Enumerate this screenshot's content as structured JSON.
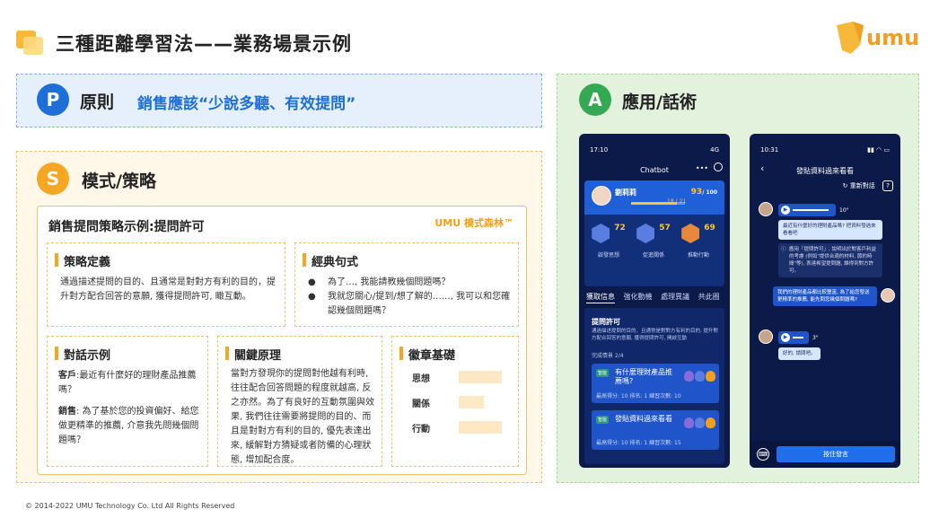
{
  "header": {
    "title": "三種距離學習法——業務場景示例",
    "logo_text": "umu"
  },
  "principle": {
    "badge": "P",
    "label": "原則",
    "text": "銷售應該“少說多聽、有效提問”"
  },
  "strategy": {
    "badge": "S",
    "label": "模式/策略",
    "card_title": "銷售提問策略示例:提問許可",
    "brand": "UMU 模式森林™",
    "definition": {
      "title": "策略定義",
      "text": "通過描述提問的目的、且通常是對對方有利的目的，提升對方配合回答的意願, 獲得提問許可, 瞰互動。"
    },
    "classic": {
      "title": "經典句式",
      "items": [
        "為了…, 我能請教幾個問題嗎？",
        "我就您關心/提到/想了解的……, 我可以和您確認幾個問題嗎？"
      ]
    },
    "dialog": {
      "title": "對話示例",
      "customer_label": "客戶",
      "customer_text": ":最近有什麼好的理財產品推薦嗎？",
      "sales_label": "銷售",
      "sales_text": ": 為了基於您的投資偏好、給您做更精準的推薦, 介意我先問幾個問題嗎？"
    },
    "key": {
      "title": "關鍵原理",
      "text": "當對方發現你的提問對他越有利時, 往往配合回答問題的程度就越高, 反之亦然。為了有良好的互動氛圍與效果, 我們往往需要將提問的目的、而且是對對方有利的目的, 優先表達出來, 緩解對方猜疑或者防備的心理狀態, 增加配合度。"
    },
    "badge_base": {
      "title": "徽章基礎",
      "rows": [
        "思想",
        "關係",
        "行動"
      ]
    }
  },
  "application": {
    "badge": "A",
    "label": "應用/話術",
    "phone1": {
      "time": "17:10",
      "signal": "4G",
      "title": "Chatbot",
      "name": "劉莉莉",
      "score": "93",
      "score_total": "/ 100",
      "progress_text": "18 / 21",
      "progress": 0.857,
      "badges": [
        {
          "num": "72",
          "label": "啟發思想"
        },
        {
          "num": "57",
          "label": "促進關係"
        },
        {
          "num": "69",
          "label": "推動行動"
        }
      ],
      "tabs": [
        "獲取信息",
        "強化動機",
        "處理異議",
        "共此圈"
      ],
      "lesson_title": "提問許可",
      "lesson_desc": "通過描述提問的目的、且通常是對對方有利的目的, 提升對方配合回答的意願, 獲得提問許可, 開啟互動",
      "done_text": "完成情景 2/4",
      "tasks": [
        {
          "tag": "智能",
          "name": "有什麼理財產品推薦嗎?",
          "meta": "最高得分: 10  排名: 1  練習次數: 10"
        },
        {
          "tag": "智能",
          "name": "發貼資料過來看看",
          "meta": "最高得分: 10  排名: 1  練習次數: 15"
        }
      ]
    },
    "phone2": {
      "time": "10:31",
      "title": "發貼資料過來看看",
      "restart": "重新對話",
      "help": "?",
      "msg1_dur": "10\"",
      "msg1_text": "最近有什麼好的理財產品嗎? 把資料發過來看看吧",
      "hint": "應用「提問許可」, 說明出於對客戶利益的考慮 (例如\"提供合適的材料, 節約時間\"等), 表達希望提問題, 誰得到對方許可。",
      "reply": "我們的理財產品都比較豐富, 為了給您發送更精準的推薦, 能先問您幾個問題嗎?",
      "msg2_dur": "3\"",
      "msg2_text": "好的, 請問吧。",
      "send_label": "按住發言"
    }
  },
  "footer": "© 2014-2022 UMU Technology Co. Ltd All Rights Reserved",
  "colors": {
    "blue": "#1f6fd8",
    "orange": "#f5a623",
    "green": "#34a853",
    "phone_bg": "#0c1a4a"
  }
}
